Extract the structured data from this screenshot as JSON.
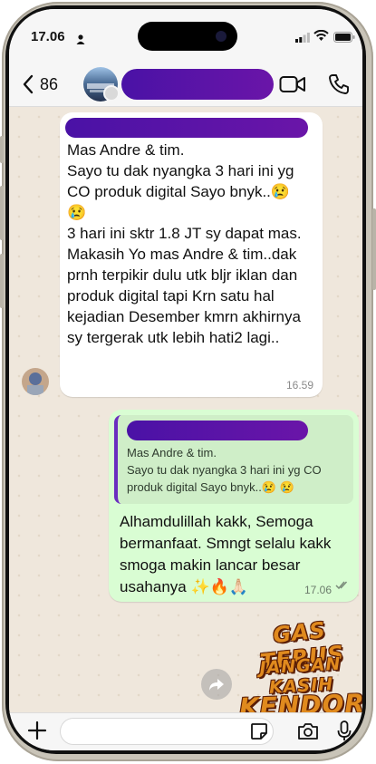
{
  "status_bar": {
    "time": "17.06"
  },
  "header": {
    "back_count": "86"
  },
  "messages": {
    "incoming": {
      "text": "Mas Andre & tim.\nSayo tu dak nyangka 3 hari ini yg CO produk digital Sayo bnyk..😢\n😢\n3 hari ini sktr 1.8 JT sy dapat mas.\nMakasih Yo mas Andre & tim..dak prnh terpikir dulu utk bljr iklan dan produk digital tapi Krn satu hal kejadian Desember kmrn akhirnya sy tergerak utk lebih hati2 lagi..",
      "time": "16.59"
    },
    "outgoing": {
      "quote": "Mas Andre & tim.\nSayo tu dak nyangka 3 hari ini yg CO produk digital Sayo bnyk..😢 😢",
      "text": "Alhamdulillah kakk, Semoga bermanfaat. Smngt selalu kakk smoga makin lancar besar usahanya ✨🔥🙏🏻",
      "time": "17.06"
    }
  },
  "sticker": {
    "line1": "GAS TERUS",
    "line2": "JANGAN KASIH",
    "line3": "KENDOR",
    "colors": {
      "fill": "#e08a1e",
      "outline": "#5a1e06"
    }
  },
  "input": {
    "placeholder": ""
  },
  "colors": {
    "redaction": "#5a14a8",
    "outgoing_bubble": "#d9fdd3",
    "incoming_bubble": "#ffffff",
    "chat_background": "#efe7dc"
  },
  "icons": [
    "person-icon",
    "signal-icon",
    "wifi-icon",
    "battery-icon",
    "back-icon",
    "video-call-icon",
    "phone-call-icon",
    "forward-icon",
    "plus-icon",
    "sticker-icon",
    "camera-icon",
    "mic-icon",
    "double-check-icon"
  ]
}
